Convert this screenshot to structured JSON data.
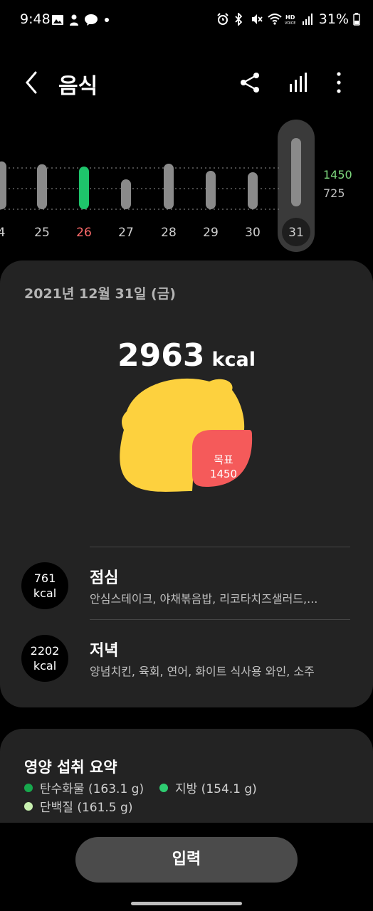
{
  "status_bar": {
    "time": "9:48",
    "battery": "31%",
    "icons_left": [
      "gallery-icon",
      "person-icon",
      "talk-icon",
      "dot-icon"
    ],
    "icons_right": [
      "alarm-icon",
      "bluetooth-icon",
      "mute-icon",
      "wifi-icon",
      "hd-voice-icon",
      "signal-icon",
      "battery-icon"
    ]
  },
  "app_bar": {
    "title": "음식",
    "actions": [
      "share-icon",
      "chart-icon",
      "more-icon"
    ]
  },
  "daily_chart": {
    "days": [
      "4",
      "25",
      "26",
      "27",
      "28",
      "29",
      "30",
      "31"
    ],
    "values": [
      1680,
      1580,
      1500,
      1050,
      1600,
      1350,
      1300,
      2963
    ],
    "highlight_day": "26",
    "selected_day": "31",
    "goal_value_label": "1450",
    "half_value_label": "725",
    "colors": {
      "bar": "#8a8a8a",
      "bar_goal_met": "#1ec46b",
      "highlight_text": "#ff6b6b",
      "goal_label": "#7ed97e"
    }
  },
  "summary": {
    "date": "2021년 12월 31일 (금)",
    "total_kcal": "2963",
    "kcal_unit": "kcal",
    "goal_label": "목표",
    "goal_value": "1450",
    "colors": {
      "lemon": "#fdd13e",
      "goal_blob": "#f55a5a"
    }
  },
  "meals": [
    {
      "kcal": "761",
      "unit": "kcal",
      "name": "점심",
      "items": "안심스테이크, 야채볶음밥, 리코타치즈샐러드,..."
    },
    {
      "kcal": "2202",
      "unit": "kcal",
      "name": "저녁",
      "items": "양념치킨, 육회, 연어, 화이트 식사용 와인, 소주"
    }
  ],
  "nutrition": {
    "title": "영양 섭취 요약",
    "items": [
      {
        "label": "탄수화물 (163.1 g)",
        "color": "#17a84d"
      },
      {
        "label": "지방 (154.1 g)",
        "color": "#2ecc71"
      },
      {
        "label": "단백질 (161.5 g)",
        "color": "#c8f0b0"
      }
    ]
  },
  "input_button": {
    "label": "입력"
  }
}
